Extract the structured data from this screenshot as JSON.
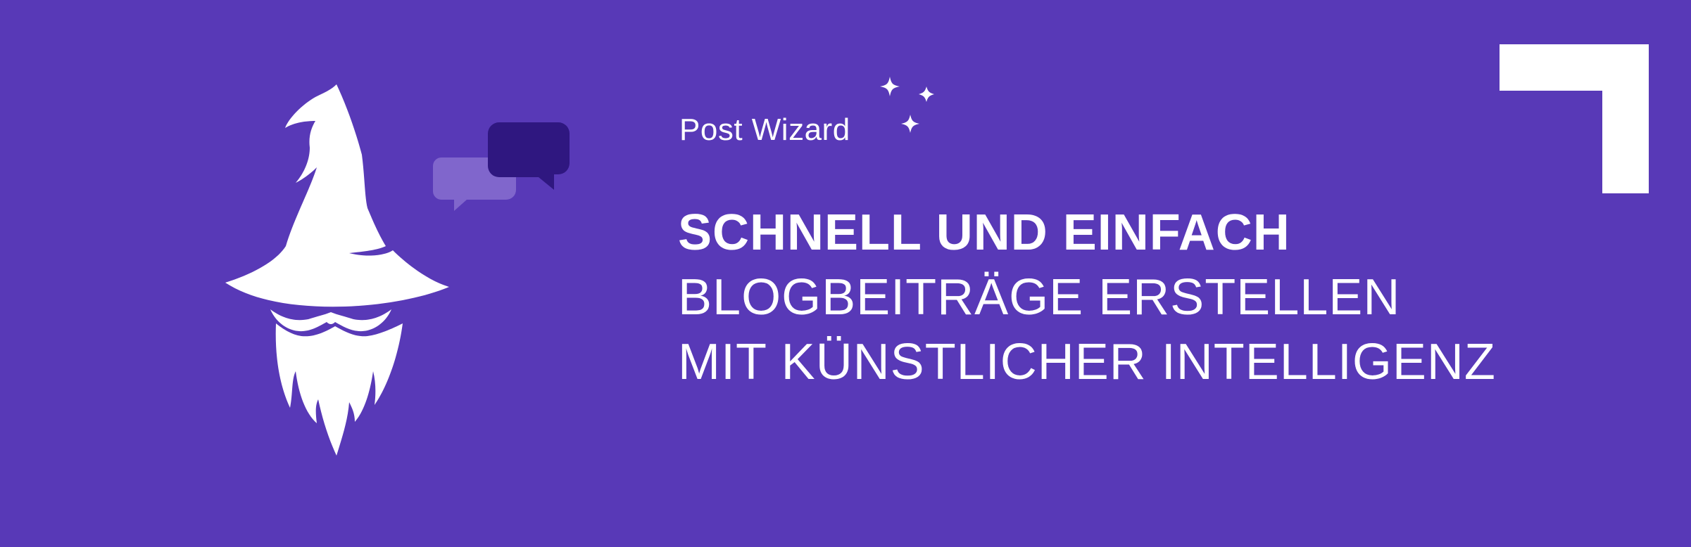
{
  "brand": {
    "name": "Post Wizard"
  },
  "headline": {
    "line1": "SCHNELL UND EINFACH",
    "line2": "BLOGBEITRÄGE ERSTELLEN",
    "line3": "MIT KÜNSTLICHER INTELLIGENZ"
  },
  "icons": {
    "wizard": "wizard-hat-beard-icon",
    "chat": "chat-bubbles-icon",
    "sparkles": "sparkles-icon",
    "corner": "corner-bracket-icon"
  },
  "colors": {
    "background": "#5839b7",
    "foreground": "#ffffff",
    "bubble_light": "#8066cc",
    "bubble_dark": "#2f1780"
  }
}
